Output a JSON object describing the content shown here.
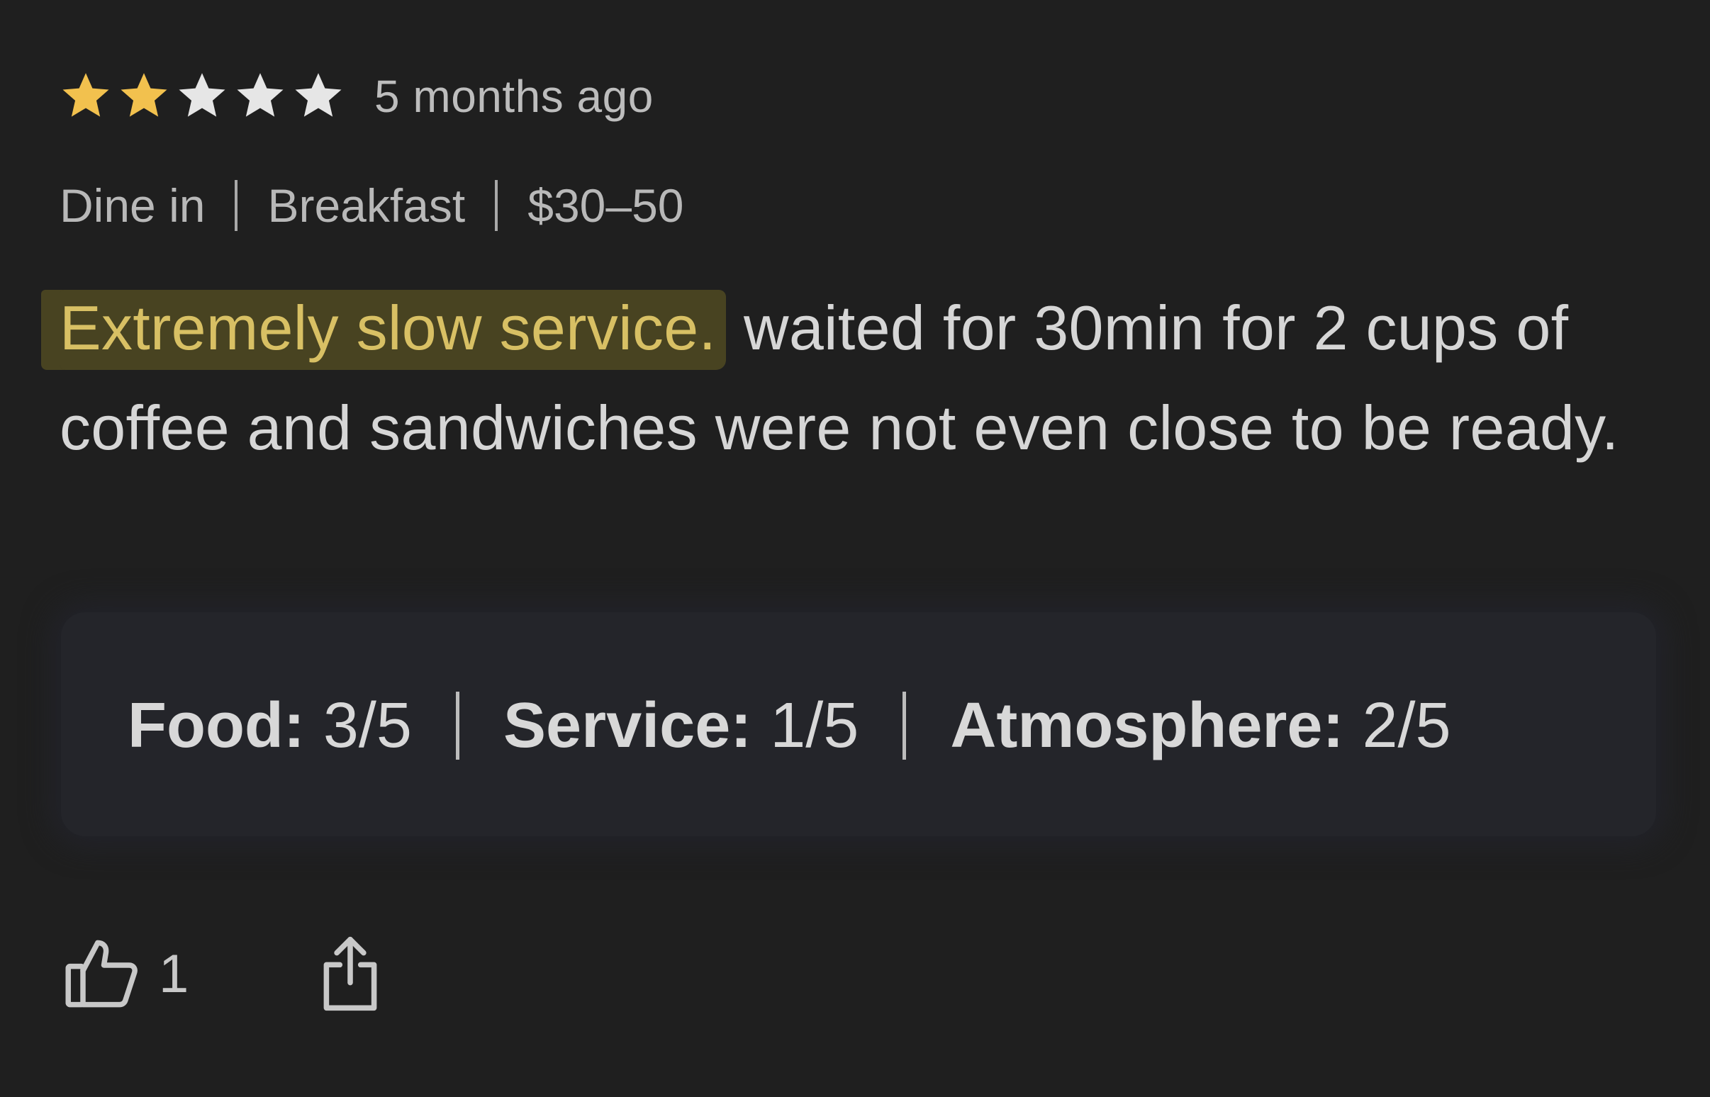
{
  "review": {
    "rating": 2,
    "max_rating": 5,
    "timestamp": "5 months ago",
    "meta": {
      "service_type": "Dine in",
      "meal_type": "Breakfast",
      "price_range": "$30–50"
    },
    "text_highlighted": "Extremely slow service.",
    "text_rest": " waited for 30min for 2 cups of coffee and sandwiches were not even close to be ready.",
    "scores": [
      {
        "label": "Food:",
        "value": "3/5"
      },
      {
        "label": "Service:",
        "value": "1/5"
      },
      {
        "label": "Atmosphere:",
        "value": "2/5"
      }
    ],
    "like_count": "1"
  },
  "icons": {
    "star": "star-icon",
    "like": "thumbs-up-icon",
    "share": "share-icon"
  },
  "colors": {
    "background": "#1f1f1f",
    "star_filled": "#f2c14e",
    "star_empty": "#e6e6e6",
    "highlight_text": "#d8c064",
    "scores_box": "#24252a"
  }
}
